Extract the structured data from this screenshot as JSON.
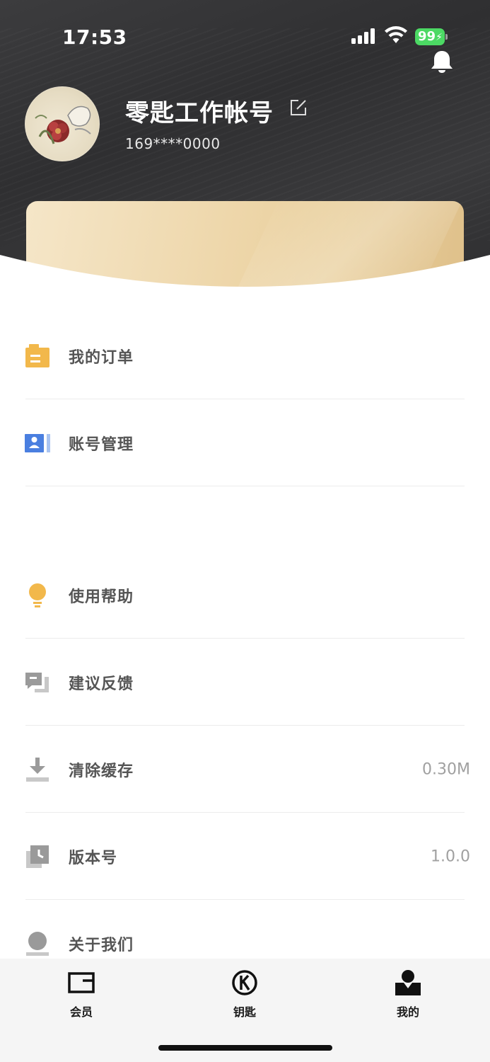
{
  "status_bar": {
    "time": "17:53",
    "battery": "99"
  },
  "profile": {
    "username": "零匙工作帐号",
    "phone": "169****0000"
  },
  "menu": {
    "group1": [
      {
        "label": "我的订单",
        "icon": "order-icon",
        "color": "#f2b84b"
      },
      {
        "label": "账号管理",
        "icon": "account-card-icon",
        "color": "#4a7fe0"
      }
    ],
    "group2": [
      {
        "label": "使用帮助",
        "icon": "lightbulb-icon",
        "color": "#f2b84b"
      },
      {
        "label": "建议反馈",
        "icon": "feedback-icon",
        "color": "#9a9a9a"
      },
      {
        "label": "清除缓存",
        "icon": "download-icon",
        "value": "0.30M",
        "color": "#9a9a9a"
      },
      {
        "label": "版本号",
        "icon": "clock-icon",
        "value": "1.0.0",
        "color": "#9a9a9a"
      },
      {
        "label": "关于我们",
        "icon": "person-icon",
        "color": "#9a9a9a"
      }
    ]
  },
  "tabs": [
    {
      "label": "会员",
      "icon": "wallet-icon"
    },
    {
      "label": "钥匙",
      "icon": "key-logo-icon"
    },
    {
      "label": "我的",
      "icon": "profile-icon",
      "active": true
    }
  ],
  "colors": {
    "header_bg": "#333335",
    "accent_gold": "#e9cf9c",
    "text": "#555555"
  }
}
